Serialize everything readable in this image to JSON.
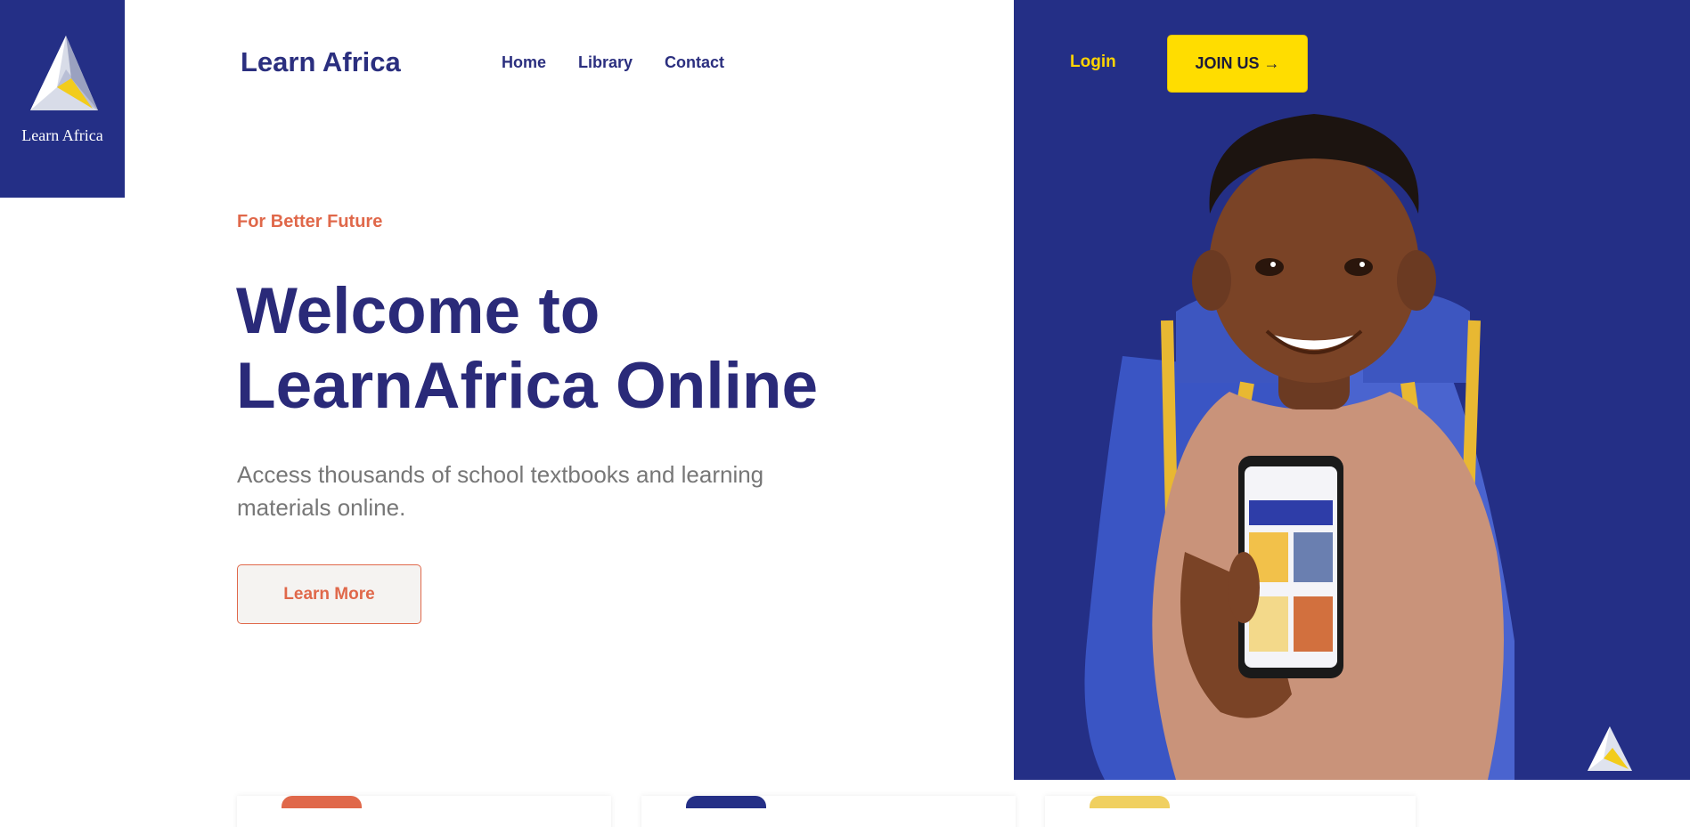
{
  "logo": {
    "caption": "Learn Africa"
  },
  "header": {
    "brand": "Learn Africa",
    "nav": [
      {
        "label": "Home"
      },
      {
        "label": "Library"
      },
      {
        "label": "Contact"
      }
    ],
    "login_label": "Login",
    "join_label": "JOIN US →"
  },
  "hero": {
    "tagline": "For Better Future",
    "headline_line1": "Welcome to",
    "headline_line2": "LearnAfrica Online",
    "subtext": "Access thousands of school textbooks and learning materials online.",
    "cta_label": "Learn More"
  },
  "colors": {
    "brand_blue": "#242f86",
    "accent_yellow": "#ffdd00",
    "accent_orange": "#e0684a",
    "heading_navy": "#2a2a79"
  },
  "cards": [
    {
      "tab_color": "#e0684a"
    },
    {
      "tab_color": "#242f86"
    },
    {
      "tab_color": "#f0d060"
    }
  ],
  "images": {
    "hero_image": "boy-with-backpack-holding-phone",
    "corner_icon": "learn-africa-logo-icon"
  }
}
